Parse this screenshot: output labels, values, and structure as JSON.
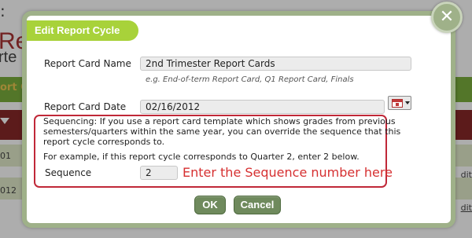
{
  "background": {
    "colon": ":",
    "title_fragment": "Re",
    "subtitle_fragment": "rte",
    "band_fragment": "ort C",
    "row1_fragment": "01",
    "row2_fragment": "012",
    "edit_label": "dit"
  },
  "dialog": {
    "title": "Edit Report Cycle",
    "close_glyph": "✕"
  },
  "form": {
    "name_label": "Report Card Name",
    "name_value": "2nd Trimester Report Cards",
    "name_hint": "e.g. End-of-term Report Card, Q1 Report Card, Finals",
    "date_label": "Report Card Date",
    "date_value": "02/16/2012"
  },
  "sequence": {
    "line1": "Sequencing: If you use a report card template which shows grades from previous",
    "line2": "semesters/quarters within the same year, you can override the sequence that this",
    "line3": "report cycle corresponds to.",
    "example": "For example, if this report cycle corresponds to Quarter 2, enter 2 below.",
    "label": "Sequence",
    "value": "2",
    "annotation": "Enter the Sequence number here"
  },
  "buttons": {
    "ok": "OK",
    "cancel": "Cancel"
  },
  "colors": {
    "title_bar": "#a8d23a",
    "dialog_border": "#9fb189",
    "button": "#6f8a5d",
    "highlight": "#c02838"
  }
}
